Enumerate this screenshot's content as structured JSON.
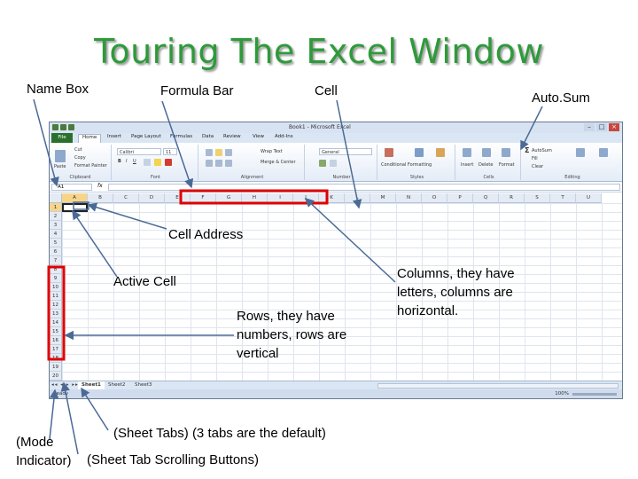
{
  "title": "Touring The Excel Window",
  "labels": {
    "name_box": "Name Box",
    "formula_bar": "Formula Bar",
    "cell": "Cell",
    "autosum": "Auto.Sum",
    "cell_address": "Cell Address",
    "active_cell": "Active Cell",
    "rows": "Rows, they have numbers, rows are vertical",
    "columns": "Columns, they have letters, columns are horizontal.",
    "sheet_tabs": "(Sheet Tabs) (3 tabs are the default)",
    "mode_indicator": "(Mode Indicator)",
    "sheet_tab_scroll": "(Sheet Tab Scrolling Buttons)"
  },
  "excel": {
    "window_title": "Book1 - Microsoft Excel",
    "window_buttons": [
      "–",
      "□",
      "×"
    ],
    "tabs": [
      "File",
      "Home",
      "Insert",
      "Page Layout",
      "Formulas",
      "Data",
      "Review",
      "View",
      "Add-Ins"
    ],
    "ribbon": {
      "clipboard": {
        "paste": "Paste",
        "cut": "Cut",
        "copy": "Copy",
        "format_painter": "Format Painter",
        "group": "Clipboard"
      },
      "font": {
        "name": "Calibri",
        "size": "11",
        "bold": "B",
        "italic": "I",
        "underline": "U",
        "group": "Font"
      },
      "alignment": {
        "wrap": "Wrap Text",
        "merge": "Merge & Center",
        "group": "Alignment"
      },
      "number": {
        "format": "General",
        "group": "Number"
      },
      "styles": {
        "conditional": "Conditional Formatting",
        "format_table": "Format as Table",
        "cell_styles": "Cell Styles",
        "group": "Styles"
      },
      "cells": {
        "insert": "Insert",
        "delete": "Delete",
        "format": "Format",
        "group": "Cells"
      },
      "editing": {
        "autosum": "AutoSum",
        "fill": "Fill",
        "clear": "Clear",
        "sort": "Sort & Filter",
        "find": "Find & Select",
        "group": "Editing"
      }
    },
    "name_box_value": "A1",
    "fx": "fx",
    "columns": [
      "A",
      "B",
      "C",
      "D",
      "E",
      "F",
      "G",
      "H",
      "I",
      "J",
      "K",
      "L",
      "M",
      "N",
      "O",
      "P",
      "Q",
      "R",
      "S",
      "T",
      "U"
    ],
    "rows": [
      "1",
      "2",
      "3",
      "4",
      "5",
      "6",
      "7",
      "8",
      "9",
      "10",
      "11",
      "12",
      "13",
      "14",
      "15",
      "16",
      "17",
      "18",
      "19",
      "20"
    ],
    "scroll_buttons": "◂◂ ◂ ▸ ▸▸",
    "sheets": [
      "Sheet1",
      "Sheet2",
      "Sheet3"
    ],
    "status": "Ready",
    "zoom": "100%"
  },
  "colors": {
    "title": "#2e9a3a",
    "highlight_box": "#e00000",
    "callout_line": "#4a6a96"
  }
}
